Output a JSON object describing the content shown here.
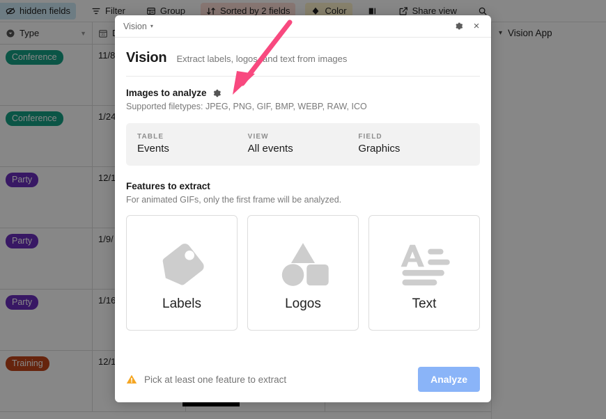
{
  "app": {
    "toolbar": [
      {
        "label": "hidden fields",
        "icon": "eye-slash-icon",
        "style": "hidden"
      },
      {
        "label": "Filter",
        "icon": "filter-icon",
        "style": "plain"
      },
      {
        "label": "Group",
        "icon": "group-icon",
        "style": "plain"
      },
      {
        "label": "Sorted by 2 fields",
        "icon": "sort-icon",
        "style": "sorted"
      },
      {
        "label": "Color",
        "icon": "paint-icon",
        "style": "color"
      },
      {
        "label": "",
        "icon": "row-height-icon",
        "style": "plain"
      },
      {
        "label": "Share view",
        "icon": "share-icon",
        "style": "plain"
      },
      {
        "label": "",
        "icon": "search-icon",
        "style": "plain"
      }
    ],
    "right_panel": {
      "title": "Vision App",
      "caret": "▾"
    },
    "grid": {
      "columns": [
        {
          "label": "Type",
          "icon": "single-select-icon"
        },
        {
          "label": "D",
          "icon": "date-icon"
        }
      ],
      "rows": [
        {
          "type": "Conference",
          "type_color": "#16a085",
          "date": "11/8"
        },
        {
          "type": "Conference",
          "type_color": "#16a085",
          "date": "1/24"
        },
        {
          "type": "Party",
          "type_color": "#6b2fbe",
          "date": "12/1"
        },
        {
          "type": "Party",
          "type_color": "#6b2fbe",
          "date": "1/9/"
        },
        {
          "type": "Party",
          "type_color": "#6b2fbe",
          "date": "1/16"
        },
        {
          "type": "Training",
          "type_color": "#c1441a",
          "date": "12/1"
        }
      ]
    }
  },
  "modal": {
    "topbar": {
      "title": "Vision",
      "caret": "▾",
      "settings_icon": "gear-icon",
      "close_icon": "close-icon",
      "close_glyph": "×"
    },
    "header": {
      "title": "Vision",
      "subtitle": "Extract labels, logos, and text from images"
    },
    "images_section": {
      "title": "Images to analyze",
      "gear_icon": "gear-icon",
      "note": "Supported filetypes: JPEG, PNG, GIF, BMP, WEBP, RAW, ICO"
    },
    "context": [
      {
        "label": "TABLE",
        "value": "Events"
      },
      {
        "label": "VIEW",
        "value": "All events"
      },
      {
        "label": "FIELD",
        "value": "Graphics"
      }
    ],
    "features_section": {
      "title": "Features to extract",
      "note": "For animated GIFs, only the first frame will be analyzed."
    },
    "feature_cards": [
      {
        "label": "Labels",
        "icon": "tag-icon"
      },
      {
        "label": "Logos",
        "icon": "shapes-icon"
      },
      {
        "label": "Text",
        "icon": "text-lines-icon"
      }
    ],
    "footer": {
      "warning_icon": "warning-triangle-icon",
      "warning_text": "Pick at least one feature to extract",
      "analyze_label": "Analyze"
    }
  },
  "annotation": {
    "arrow": "pink-arrow-pointing-to-images-gear",
    "color": "#f8497f"
  },
  "colors": {
    "accent_button": "#8ab4f8",
    "warning": "#f5a623",
    "arrow_pink": "#f8497f",
    "chip_conference": "#16a085",
    "chip_party": "#6b2fbe",
    "chip_training": "#c1441a"
  }
}
